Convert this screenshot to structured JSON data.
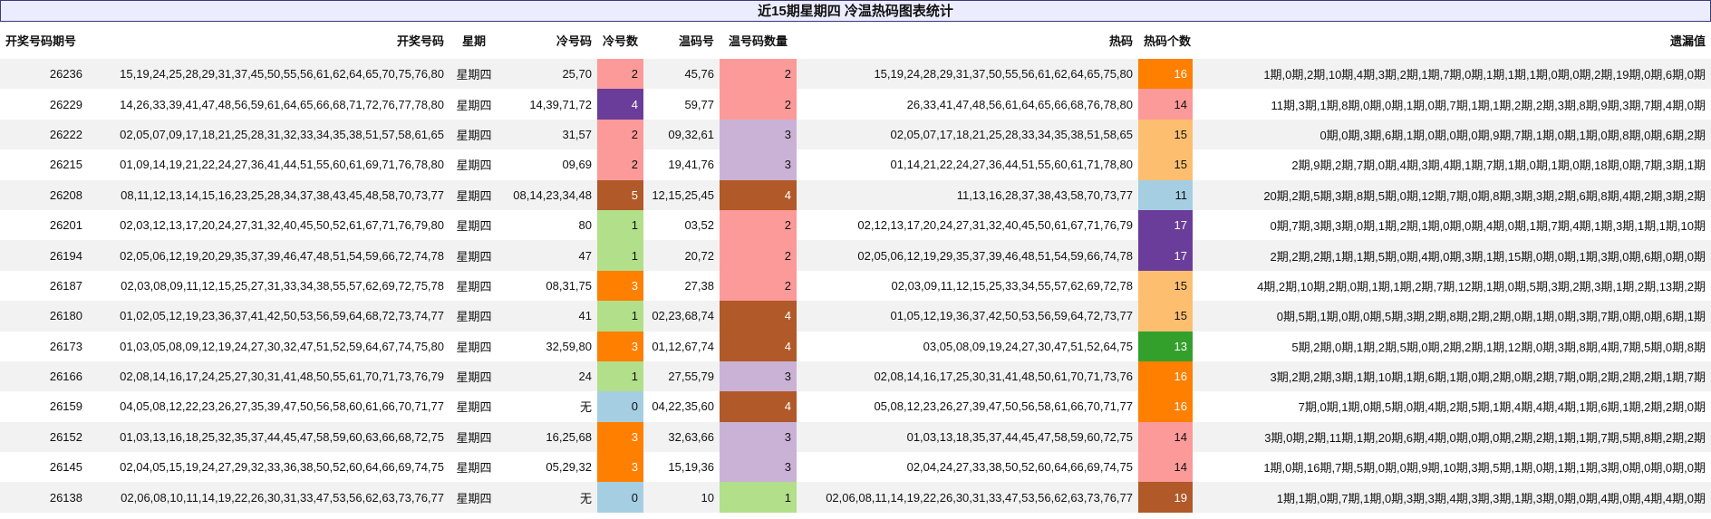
{
  "title": "近15期星期四 冷温热码图表统计",
  "headers": [
    "开奖号码期号",
    "开奖号码",
    "星期",
    "冷号码",
    "冷号数",
    "温码号",
    "温号码数量",
    "热码",
    "热码个数",
    "遗漏值"
  ],
  "count_colors": {
    "0": "#a6cee3",
    "1": "#b2df8a",
    "2": "#fb9a99",
    "3": "#cab2d6",
    "4": "#b15928",
    "5": "#b15928",
    "11": "#a6cee3",
    "13": "#33a02c",
    "14": "#fb9a99",
    "15": "#fdbf6f",
    "16": "#ff7f00",
    "17": "#6a3d9a",
    "19": "#b15928"
  },
  "cold_colors": {
    "0": "#a6cee3",
    "1": "#b2df8a",
    "2": "#fb9a99",
    "3": "#ff7f00",
    "4": "#6a3d9a",
    "5": "#b15928"
  },
  "rows": [
    {
      "issue": "26236",
      "numbers": "15,19,24,25,28,29,31,37,45,50,55,56,61,62,64,65,70,75,76,80",
      "weekday": "星期四",
      "cold": "25,70",
      "cold_n": "2",
      "warm": "45,76",
      "warm_n": "2",
      "hot": "15,19,24,28,29,31,37,50,55,56,61,62,64,65,75,80",
      "hot_n": "16",
      "miss": "1期,0期,2期,10期,4期,3期,2期,1期,7期,0期,1期,1期,1期,0期,0期,2期,19期,0期,6期,0期"
    },
    {
      "issue": "26229",
      "numbers": "14,26,33,39,41,47,48,56,59,61,64,65,66,68,71,72,76,77,78,80",
      "weekday": "星期四",
      "cold": "14,39,71,72",
      "cold_n": "4",
      "warm": "59,77",
      "warm_n": "2",
      "hot": "26,33,41,47,48,56,61,64,65,66,68,76,78,80",
      "hot_n": "14",
      "miss": "11期,3期,1期,8期,0期,0期,1期,0期,7期,1期,1期,2期,2期,3期,8期,9期,3期,7期,4期,0期"
    },
    {
      "issue": "26222",
      "numbers": "02,05,07,09,17,18,21,25,28,31,32,33,34,35,38,51,57,58,61,65",
      "weekday": "星期四",
      "cold": "31,57",
      "cold_n": "2",
      "warm": "09,32,61",
      "warm_n": "3",
      "hot": "02,05,07,17,18,21,25,28,33,34,35,38,51,58,65",
      "hot_n": "15",
      "miss": "0期,0期,3期,6期,1期,0期,0期,0期,9期,7期,1期,0期,1期,0期,8期,0期,6期,2期"
    },
    {
      "issue": "26215",
      "numbers": "01,09,14,19,21,22,24,27,36,41,44,51,55,60,61,69,71,76,78,80",
      "weekday": "星期四",
      "cold": "09,69",
      "cold_n": "2",
      "warm": "19,41,76",
      "warm_n": "3",
      "hot": "01,14,21,22,24,27,36,44,51,55,60,61,71,78,80",
      "hot_n": "15",
      "miss": "2期,9期,2期,7期,0期,4期,3期,4期,1期,7期,1期,0期,1期,0期,18期,0期,7期,3期,1期"
    },
    {
      "issue": "26208",
      "numbers": "08,11,12,13,14,15,16,23,25,28,34,37,38,43,45,48,58,70,73,77",
      "weekday": "星期四",
      "cold": "08,14,23,34,48",
      "cold_n": "5",
      "warm": "12,15,25,45",
      "warm_n": "4",
      "hot": "11,13,16,28,37,38,43,58,70,73,77",
      "hot_n": "11",
      "miss": "20期,2期,5期,3期,8期,5期,0期,12期,7期,0期,8期,3期,3期,2期,6期,8期,4期,2期,3期,2期"
    },
    {
      "issue": "26201",
      "numbers": "02,03,12,13,17,20,24,27,31,32,40,45,50,52,61,67,71,76,79,80",
      "weekday": "星期四",
      "cold": "80",
      "cold_n": "1",
      "warm": "03,52",
      "warm_n": "2",
      "hot": "02,12,13,17,20,24,27,31,32,40,45,50,61,67,71,76,79",
      "hot_n": "17",
      "miss": "0期,7期,3期,3期,0期,1期,2期,1期,0期,0期,4期,0期,1期,7期,4期,1期,3期,1期,1期,10期"
    },
    {
      "issue": "26194",
      "numbers": "02,05,06,12,19,20,29,35,37,39,46,47,48,51,54,59,66,72,74,78",
      "weekday": "星期四",
      "cold": "47",
      "cold_n": "1",
      "warm": "20,72",
      "warm_n": "2",
      "hot": "02,05,06,12,19,29,35,37,39,46,48,51,54,59,66,74,78",
      "hot_n": "17",
      "miss": "2期,2期,2期,1期,1期,5期,0期,4期,0期,3期,1期,15期,0期,0期,1期,3期,0期,6期,0期,0期"
    },
    {
      "issue": "26187",
      "numbers": "02,03,08,09,11,12,15,25,27,31,33,34,38,55,57,62,69,72,75,78",
      "weekday": "星期四",
      "cold": "08,31,75",
      "cold_n": "3",
      "warm": "27,38",
      "warm_n": "2",
      "hot": "02,03,09,11,12,15,25,33,34,55,57,62,69,72,78",
      "hot_n": "15",
      "miss": "4期,2期,10期,2期,0期,1期,1期,2期,7期,12期,1期,0期,5期,3期,2期,3期,1期,2期,13期,2期"
    },
    {
      "issue": "26180",
      "numbers": "01,02,05,12,19,23,36,37,41,42,50,53,56,59,64,68,72,73,74,77",
      "weekday": "星期四",
      "cold": "41",
      "cold_n": "1",
      "warm": "02,23,68,74",
      "warm_n": "4",
      "hot": "01,05,12,19,36,37,42,50,53,56,59,64,72,73,77",
      "hot_n": "15",
      "miss": "0期,5期,1期,0期,0期,5期,3期,2期,8期,2期,2期,0期,1期,0期,3期,7期,0期,0期,6期,1期"
    },
    {
      "issue": "26173",
      "numbers": "01,03,05,08,09,12,19,24,27,30,32,47,51,52,59,64,67,74,75,80",
      "weekday": "星期四",
      "cold": "32,59,80",
      "cold_n": "3",
      "warm": "01,12,67,74",
      "warm_n": "4",
      "hot": "03,05,08,09,19,24,27,30,47,51,52,64,75",
      "hot_n": "13",
      "miss": "5期,2期,0期,1期,2期,5期,0期,2期,2期,1期,12期,0期,3期,8期,4期,7期,5期,0期,8期"
    },
    {
      "issue": "26166",
      "numbers": "02,08,14,16,17,24,25,27,30,31,41,48,50,55,61,70,71,73,76,79",
      "weekday": "星期四",
      "cold": "24",
      "cold_n": "1",
      "warm": "27,55,79",
      "warm_n": "3",
      "hot": "02,08,14,16,17,25,30,31,41,48,50,61,70,71,73,76",
      "hot_n": "16",
      "miss": "3期,2期,2期,3期,1期,10期,1期,6期,1期,0期,2期,0期,2期,7期,0期,2期,2期,2期,1期,7期"
    },
    {
      "issue": "26159",
      "numbers": "04,05,08,12,22,23,26,27,35,39,47,50,56,58,60,61,66,70,71,77",
      "weekday": "星期四",
      "cold": "无",
      "cold_n": "0",
      "warm": "04,22,35,60",
      "warm_n": "4",
      "hot": "05,08,12,23,26,27,39,47,50,56,58,61,66,70,71,77",
      "hot_n": "16",
      "miss": "7期,0期,1期,0期,5期,0期,4期,2期,5期,1期,4期,4期,4期,1期,6期,1期,2期,2期,0期"
    },
    {
      "issue": "26152",
      "numbers": "01,03,13,16,18,25,32,35,37,44,45,47,58,59,60,63,66,68,72,75",
      "weekday": "星期四",
      "cold": "16,25,68",
      "cold_n": "3",
      "warm": "32,63,66",
      "warm_n": "3",
      "hot": "01,03,13,18,35,37,44,45,47,58,59,60,72,75",
      "hot_n": "14",
      "miss": "3期,0期,2期,11期,1期,20期,6期,4期,0期,0期,0期,2期,2期,1期,1期,7期,5期,8期,2期,2期"
    },
    {
      "issue": "26145",
      "numbers": "02,04,05,15,19,24,27,29,32,33,36,38,50,52,60,64,66,69,74,75",
      "weekday": "星期四",
      "cold": "05,29,32",
      "cold_n": "3",
      "warm": "15,19,36",
      "warm_n": "3",
      "hot": "02,04,24,27,33,38,50,52,60,64,66,69,74,75",
      "hot_n": "14",
      "miss": "1期,0期,16期,7期,5期,0期,0期,9期,10期,3期,5期,1期,0期,1期,1期,3期,0期,0期,0期,0期"
    },
    {
      "issue": "26138",
      "numbers": "02,06,08,10,11,14,19,22,26,30,31,33,47,53,56,62,63,73,76,77",
      "weekday": "星期四",
      "cold": "无",
      "cold_n": "0",
      "warm": "10",
      "warm_n": "1",
      "hot": "02,06,08,11,14,19,22,26,30,31,33,47,53,56,62,63,73,76,77",
      "hot_n": "19",
      "miss": "1期,1期,0期,7期,1期,0期,3期,3期,4期,3期,3期,1期,3期,0期,0期,4期,0期,4期,4期,0期"
    }
  ]
}
